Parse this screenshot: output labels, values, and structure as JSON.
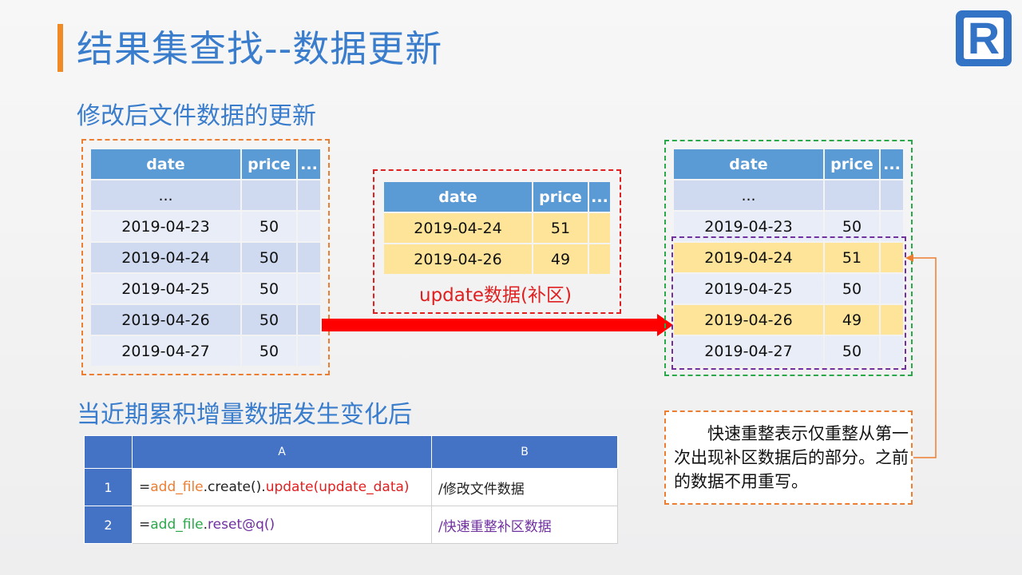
{
  "slide": {
    "title": "结果集查找--数据更新",
    "logo_letter": "R",
    "section1": "修改后文件数据的更新",
    "section2": "当近期累积增量数据发生变化后"
  },
  "left_table": {
    "headers": [
      "date",
      "price",
      "..."
    ],
    "rows": [
      [
        "...",
        "",
        ""
      ],
      [
        "2019-04-23",
        "50",
        ""
      ],
      [
        "2019-04-24",
        "50",
        ""
      ],
      [
        "2019-04-25",
        "50",
        ""
      ],
      [
        "2019-04-26",
        "50",
        ""
      ],
      [
        "2019-04-27",
        "50",
        ""
      ]
    ]
  },
  "update_table": {
    "headers": [
      "date",
      "price",
      "..."
    ],
    "rows": [
      [
        "2019-04-24",
        "51",
        ""
      ],
      [
        "2019-04-26",
        "49",
        ""
      ]
    ],
    "caption": "update数据(补区)"
  },
  "right_table": {
    "headers": [
      "date",
      "price",
      "..."
    ],
    "rows": [
      [
        "...",
        "",
        ""
      ],
      [
        "2019-04-23",
        "50",
        ""
      ],
      [
        "2019-04-24",
        "51",
        ""
      ],
      [
        "2019-04-25",
        "50",
        ""
      ],
      [
        "2019-04-26",
        "49",
        ""
      ],
      [
        "2019-04-27",
        "50",
        ""
      ]
    ]
  },
  "note": "快速重整表示仅重整从第一次出现补区数据后的部分。之前的数据不用重写。",
  "code_grid": {
    "col_headers": [
      "A",
      "B"
    ],
    "rows": [
      {
        "num": "1",
        "a": {
          "eq": "=",
          "var": "add_file",
          "dot1": ".create().",
          "call": "update(update_data)"
        },
        "b": "/修改文件数据"
      },
      {
        "num": "2",
        "a": {
          "eq": "=",
          "var": "add_file",
          "dot1": ".",
          "call": "reset@q()"
        },
        "b": "/快速重整补区数据"
      }
    ]
  },
  "colors": {
    "accent_blue": "#3a7dcc",
    "header_blue": "#5b9bd5",
    "highlight_yellow": "#fde498",
    "arrow_red": "#ff0000",
    "orange": "#ed7d31",
    "green": "#2aa84a",
    "purple": "#7030a0"
  }
}
